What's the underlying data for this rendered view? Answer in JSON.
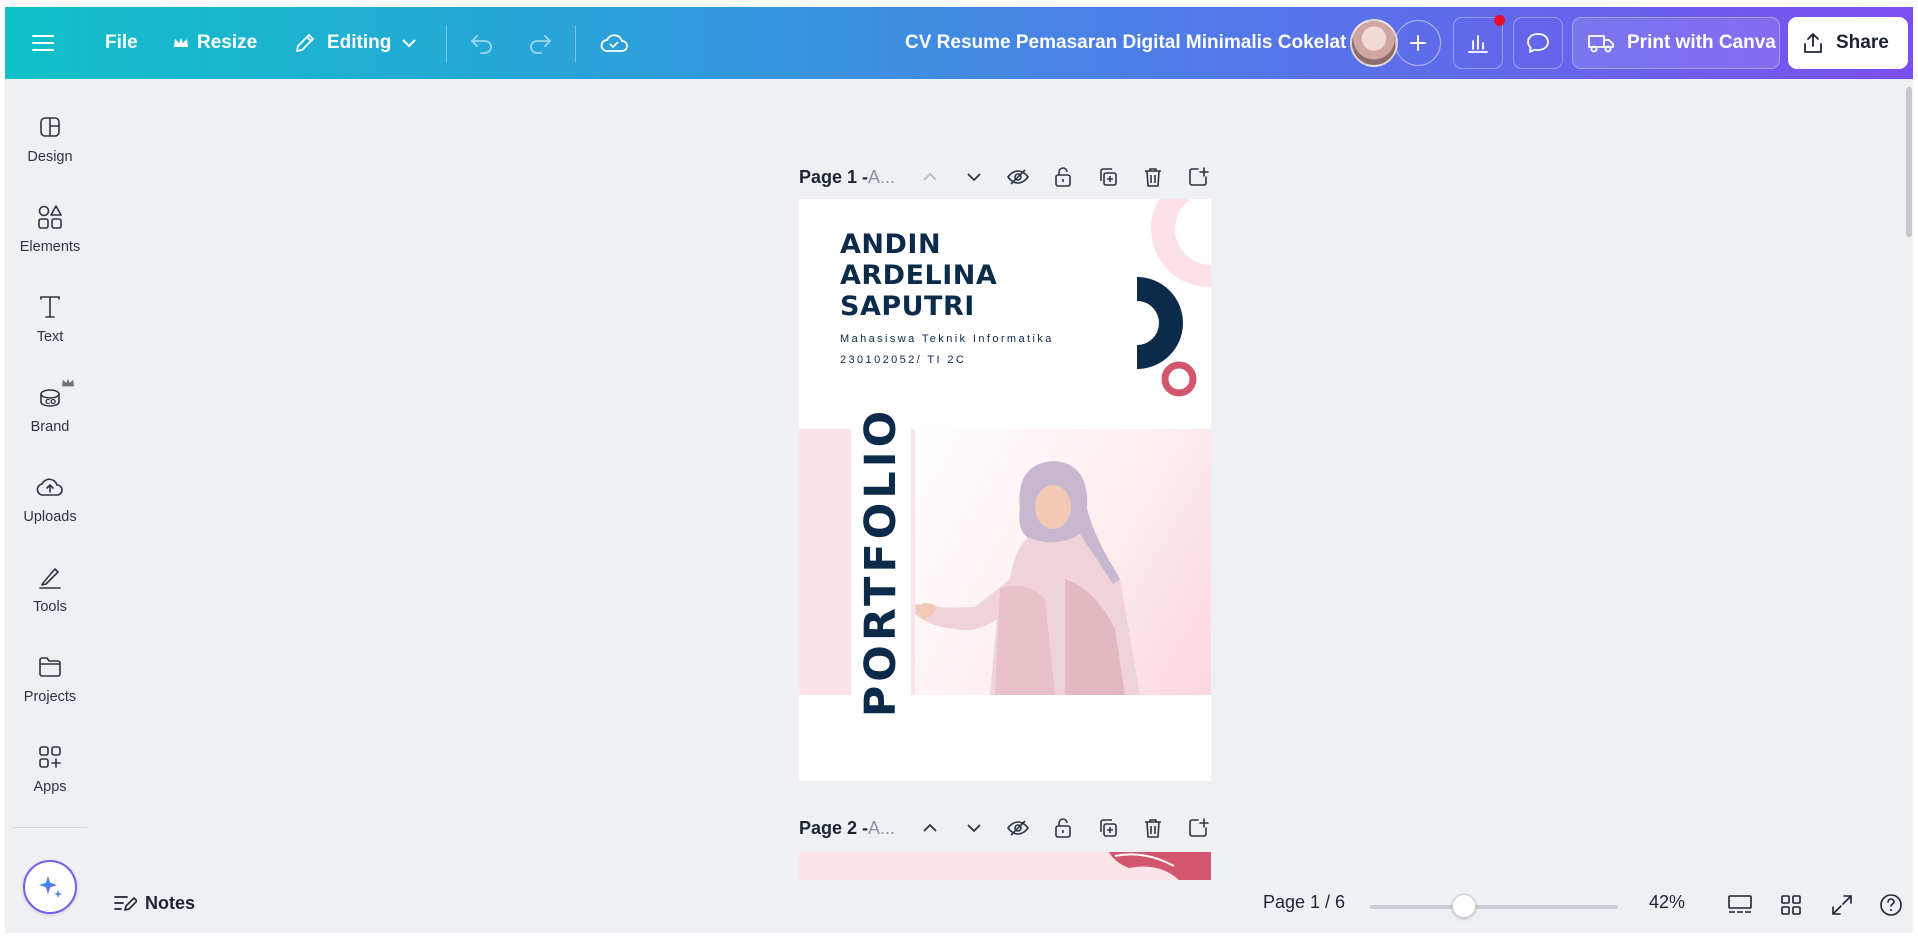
{
  "topbar": {
    "menu_icon": "hamburger-icon",
    "file_label": "File",
    "resize_label": "Resize",
    "editing_label": "Editing",
    "document_title": "CV Resume Pemasaran Digital Minimalis Cokelat",
    "print_label": "Print with Canva",
    "share_label": "Share"
  },
  "sidebar": {
    "items": [
      {
        "label": "Design",
        "icon": "design-icon"
      },
      {
        "label": "Elements",
        "icon": "elements-icon"
      },
      {
        "label": "Text",
        "icon": "text-icon"
      },
      {
        "label": "Brand",
        "icon": "brand-icon"
      },
      {
        "label": "Uploads",
        "icon": "uploads-icon"
      },
      {
        "label": "Tools",
        "icon": "tools-icon"
      },
      {
        "label": "Projects",
        "icon": "projects-icon"
      },
      {
        "label": "Apps",
        "icon": "apps-icon"
      }
    ]
  },
  "pages": [
    {
      "name": "Page 1 - ",
      "title": "A..."
    },
    {
      "name": "Page 2 - ",
      "title": "A..."
    }
  ],
  "design": {
    "name_line1": "ANDIN",
    "name_line2": "ARDELINA",
    "name_line3": "SAPUTRI",
    "subtitle": "Mahasiswa Teknik Informatika",
    "id_line": "230102052/ TI 2C",
    "vertical_word": "PORTFOLIO"
  },
  "bottombar": {
    "notes_label": "Notes",
    "page_indicator": "Page 1 / 6",
    "zoom_value": 0.42,
    "zoom_label": "42%"
  },
  "colors": {
    "navy": "#0c2a4a",
    "pink_light": "#fbe3e7",
    "rose": "#d3566f",
    "accent": "#7a5cf0"
  }
}
